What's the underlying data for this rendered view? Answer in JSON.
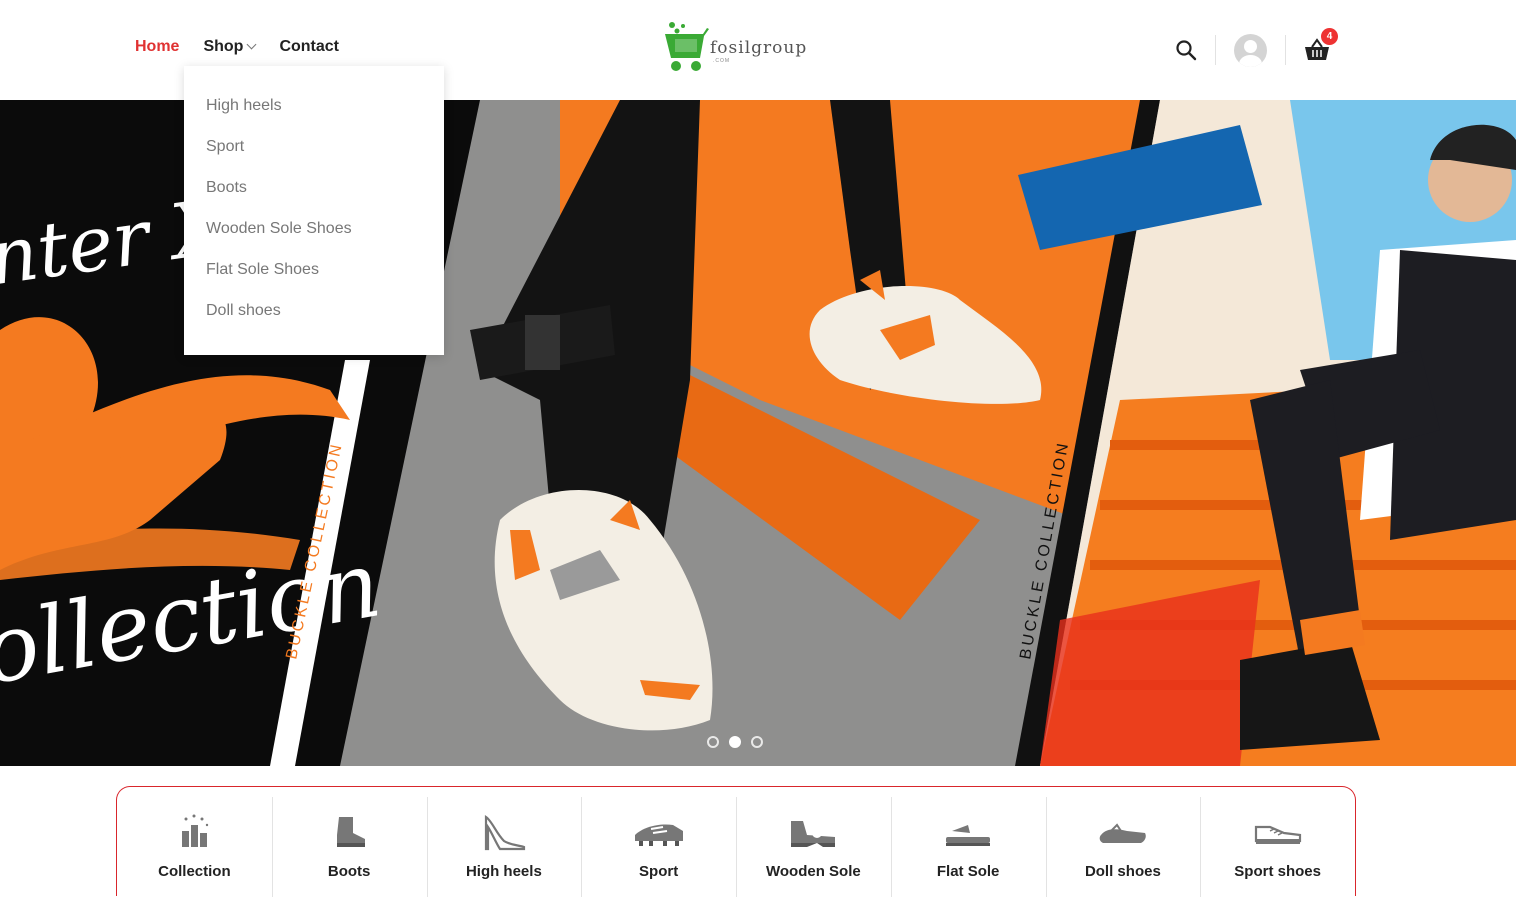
{
  "header": {
    "nav": [
      {
        "label": "Home",
        "active": true
      },
      {
        "label": "Shop",
        "has_dropdown": true
      },
      {
        "label": "Contact"
      }
    ],
    "logo": {
      "text": "fosilgroup",
      "sub": ".COM"
    },
    "cart_count": "4",
    "icons": [
      "search-icon",
      "user-avatar-icon",
      "cart-icon"
    ]
  },
  "shop_menu": [
    "High heels",
    "Sport",
    "Boots",
    "Wooden Sole Shoes",
    "Flat Sole Shoes",
    "Doll shoes"
  ],
  "hero": {
    "left_script_1": "nter X",
    "left_script_2": "ollection",
    "side_text": "BUCKLE COLLECTION",
    "active_slide": 2,
    "slide_count": 3
  },
  "categories": [
    {
      "label": "Collection",
      "icon": "collection-icon"
    },
    {
      "label": "Boots",
      "icon": "boot-icon"
    },
    {
      "label": "High heels",
      "icon": "high-heel-icon"
    },
    {
      "label": "Sport",
      "icon": "cleat-icon"
    },
    {
      "label": "Wooden Sole",
      "icon": "wooden-sole-icon"
    },
    {
      "label": "Flat Sole",
      "icon": "flat-sole-icon"
    },
    {
      "label": "Doll shoes",
      "icon": "doll-shoe-icon"
    },
    {
      "label": "Sport shoes",
      "icon": "sneaker-icon"
    }
  ],
  "colors": {
    "accent": "#e03232",
    "logo_green": "#3aaa35",
    "hero_orange": "#f47a20"
  }
}
